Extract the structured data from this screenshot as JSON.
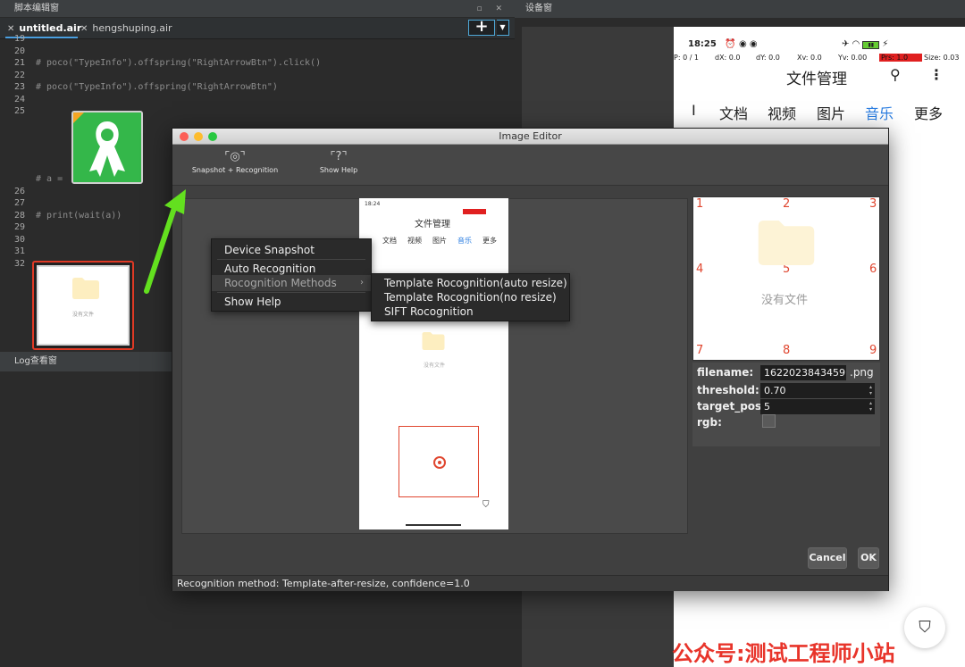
{
  "editor_window": {
    "title": "脚本编辑窗",
    "tabs": [
      {
        "label": "untitled.air"
      },
      {
        "label": "hengshuping.air"
      }
    ],
    "add_button": "+",
    "lines": [
      {
        "n": "19",
        "code": ""
      },
      {
        "n": "20",
        "code": ""
      },
      {
        "n": "21",
        "code": "# poco(\"TypeInfo\").offspring(\"RightArrowBtn\").click()"
      },
      {
        "n": "22",
        "code": ""
      },
      {
        "n": "23",
        "code": "# poco(\"TypeInfo\").offspring(\"RightArrowBtn\")"
      },
      {
        "n": "24",
        "code": ""
      },
      {
        "n": "25",
        "code": ""
      },
      {
        "n": "",
        "code": "# a ="
      },
      {
        "n": "26",
        "code": ""
      },
      {
        "n": "27",
        "code": ""
      },
      {
        "n": "28",
        "code": "# print(wait(a))"
      },
      {
        "n": "29",
        "code": ""
      },
      {
        "n": "30",
        "code": ""
      },
      {
        "n": "31",
        "code": ""
      },
      {
        "n": "32",
        "code": ""
      }
    ],
    "folder_thumb_text": "没有文件"
  },
  "log_window": {
    "title": "Log查看窗"
  },
  "device_window": {
    "title": "设备窗",
    "status_time": "18:25",
    "stats": {
      "p": "P: 0 / 1",
      "dx": "dX: 0.0",
      "dy": "dY: 0.0",
      "xv": "Xv: 0.0",
      "yv": "Yv: 0.00",
      "prs": "Prs: 1.0",
      "size": "Size: 0.03"
    },
    "app_title": "文件管理",
    "tabs": [
      {
        "label": "I"
      },
      {
        "label": "文档"
      },
      {
        "label": "视频"
      },
      {
        "label": "图片"
      },
      {
        "label": "音乐",
        "selected": true
      },
      {
        "label": "更多"
      }
    ]
  },
  "dialog": {
    "title": "Image Editor",
    "toolbar": [
      {
        "label": "Snapshot + Recognition"
      },
      {
        "label": "Show Help"
      }
    ],
    "context_menu": [
      {
        "label": "Device Snapshot"
      },
      {
        "label": "Auto Recognition"
      },
      {
        "label": "Rocognition Methods",
        "highlighted": true
      },
      {
        "label": "Show Help"
      }
    ],
    "submenu": [
      {
        "label": "Template Rocognition(auto resize)"
      },
      {
        "label": "Template Rocognition(no resize)"
      },
      {
        "label": "SIFT Rocognition"
      }
    ],
    "mini_phone": {
      "time": "18:24",
      "title": "文件管理",
      "tabs": [
        "文档",
        "视频",
        "图片",
        "音乐",
        "更多"
      ],
      "empty": "没有文件"
    },
    "grid_numbers": [
      "1",
      "2",
      "3",
      "4",
      "5",
      "6",
      "7",
      "8",
      "9"
    ],
    "grid_empty_text": "没有文件",
    "props": {
      "filename_label": "filename:",
      "filename_value": "1622023843459",
      "filename_ext": ".png",
      "threshold_label": "threshold:",
      "threshold_value": "0.70",
      "target_pos_label": "target_pos:",
      "target_pos_value": "5",
      "rgb_label": "rgb:"
    },
    "cancel_label": "Cancel",
    "ok_label": "OK",
    "status": "Recognition method: Template-after-resize, confidence=1.0"
  },
  "watermark": "公众号:测试工程师小站"
}
